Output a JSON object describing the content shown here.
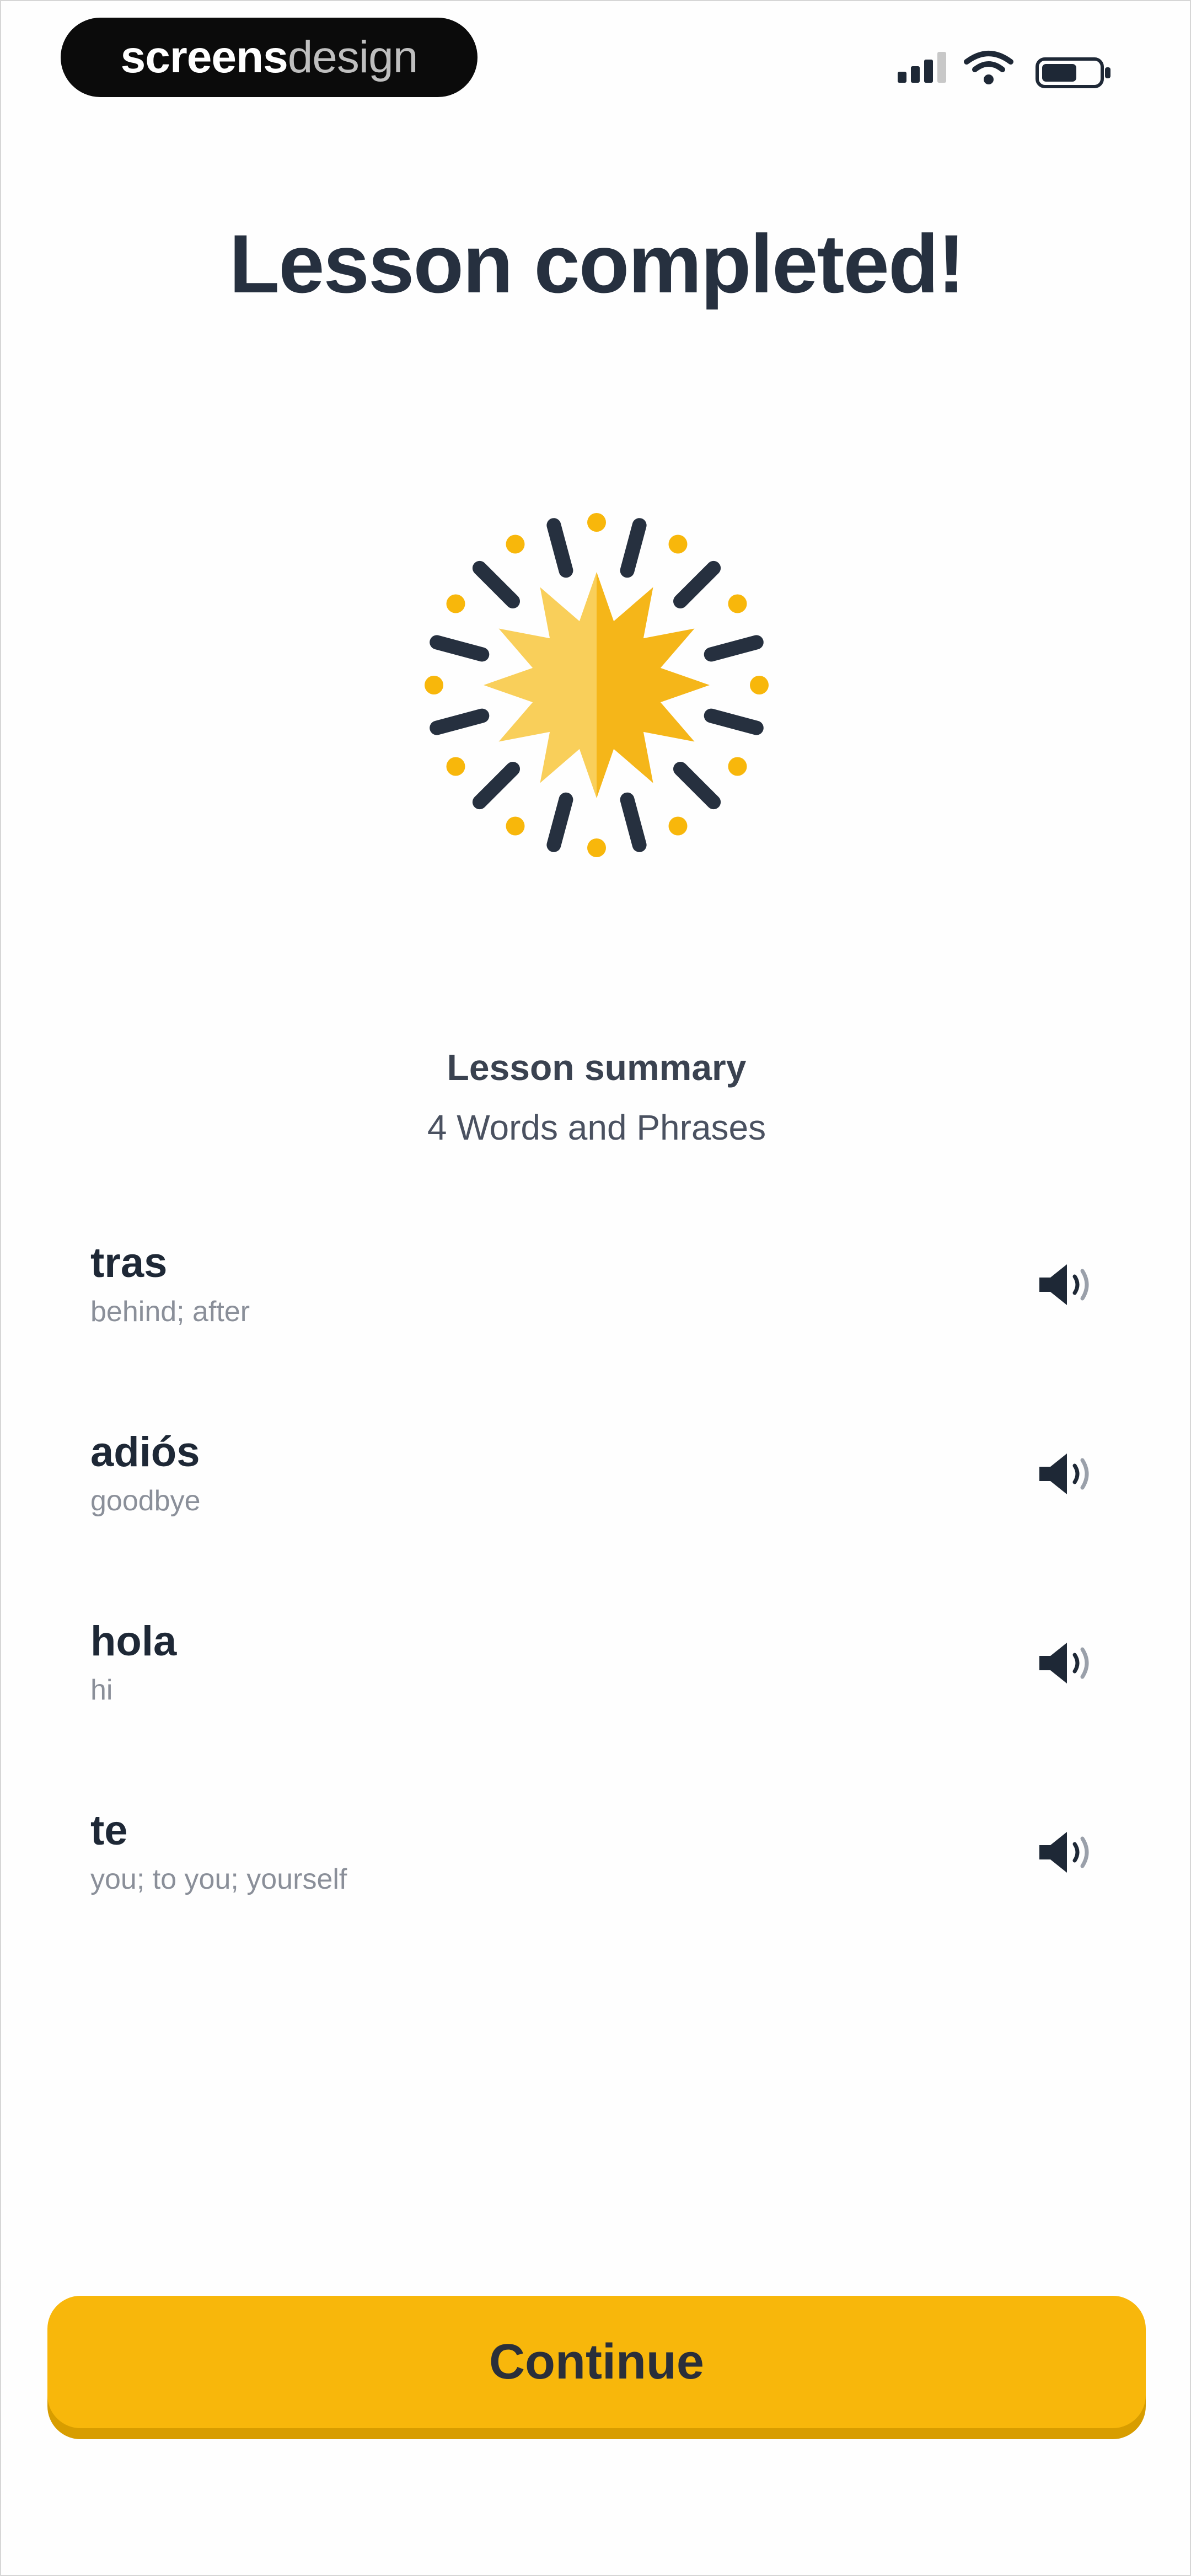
{
  "status_bar": {
    "brand_part1": "screens",
    "brand_part2": "design"
  },
  "title": "Lesson completed!",
  "summary": {
    "label": "Lesson summary",
    "count": "4 Words and Phrases"
  },
  "words": [
    {
      "word": "tras",
      "translation": "behind; after"
    },
    {
      "word": "adiós",
      "translation": "goodbye"
    },
    {
      "word": "hola",
      "translation": "hi"
    },
    {
      "word": "te",
      "translation": "you; to you; yourself"
    }
  ],
  "continue_label": "Continue",
  "colors": {
    "accent": "#f8b70b",
    "burst_light": "#f9cf5a",
    "burst_dark": "#f5b619",
    "ray": "#26303f",
    "text": "#1f2a3a"
  },
  "icons": [
    "signal-icon",
    "wifi-icon",
    "battery-icon",
    "burst-icon",
    "speaker-icon"
  ]
}
